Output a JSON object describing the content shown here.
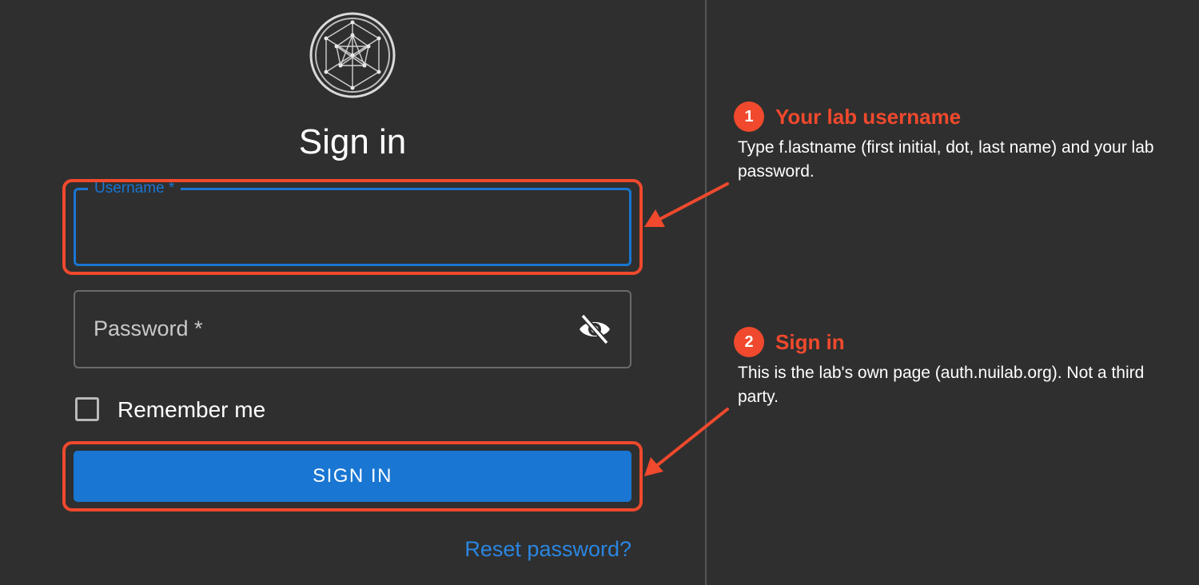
{
  "form": {
    "title": "Sign in",
    "username_label": "Username *",
    "password_label": "Password *",
    "remember_label": "Remember me",
    "signin_label": "SIGN IN",
    "reset_label": "Reset password?",
    "logo_icon": "geodesic-sphere-icon",
    "eye_icon": "eye-slash-icon"
  },
  "annotations": [
    {
      "number": "1",
      "title": "Your lab username",
      "text": "Type f.lastname (first initial, dot, last name) and your lab password."
    },
    {
      "number": "2",
      "title": "Sign in",
      "text": "This is the lab's own page (auth.nuilab.org). Not a third party."
    }
  ],
  "colors": {
    "background": "#2f2f2f",
    "accent": "#1976d2",
    "annotation": "#f0492d"
  }
}
